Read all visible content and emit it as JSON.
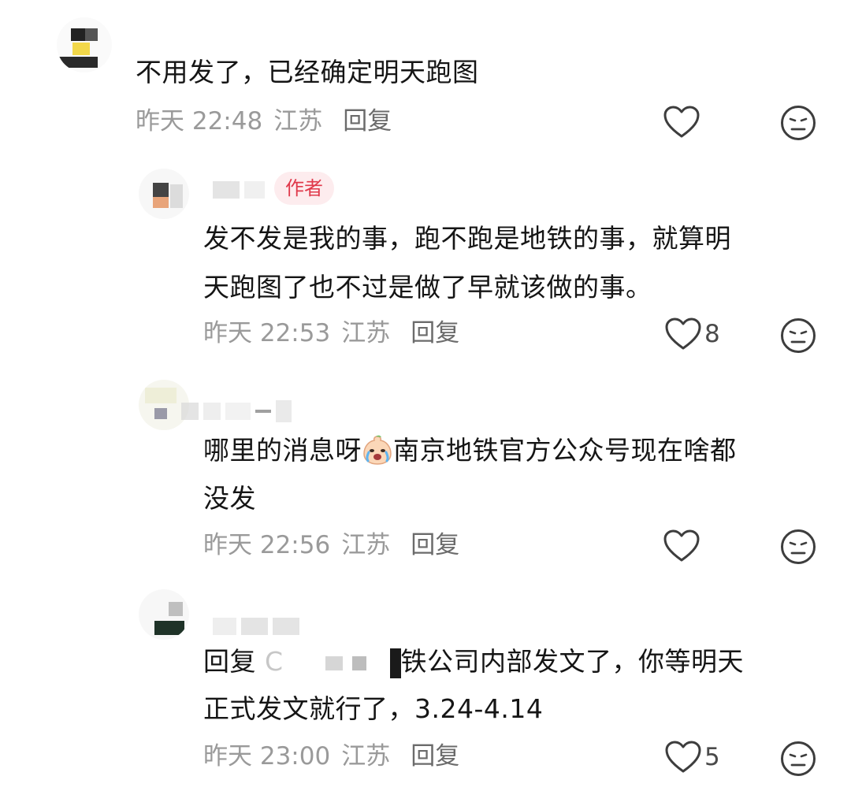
{
  "comments": [
    {
      "text": "不用发了，已经确定明天跑图",
      "time": "昨天 22:48",
      "location": "江苏",
      "reply_label": "回复",
      "likes": "",
      "like_icon": "heart-outline",
      "dislike_icon": "neutral-face"
    },
    {
      "badge": "作者",
      "text_line1": "发不发是我的事，跑不跑是地铁的事，就算明",
      "text_line2": "天跑图了也不过是做了早就该做的事。",
      "time": "昨天 22:53",
      "location": "江苏",
      "reply_label": "回复",
      "likes": "8",
      "like_icon": "heart-outline",
      "dislike_icon": "neutral-face"
    },
    {
      "text_line1_a": "哪里的消息呀",
      "text_line1_b": "南京地铁官方公众号现在啥都",
      "text_line2": "没发",
      "emoji": "crying-face",
      "time": "昨天 22:56",
      "location": "江苏",
      "reply_label": "回复",
      "likes": "",
      "like_icon": "heart-outline",
      "dislike_icon": "neutral-face"
    },
    {
      "text_line1_prefix": "回复",
      "text_line1_partial": "C",
      "text_line1_rest": "铁公司内部发文了，你等明天",
      "text_line2": "正式发文就行了，3.24-4.14",
      "time": "昨天 23:00",
      "location": "江苏",
      "reply_label": "回复",
      "likes": "5",
      "like_icon": "heart-outline",
      "dislike_icon": "neutral-face"
    }
  ],
  "colors": {
    "text": "#151515",
    "meta": "#9a9a9a",
    "reply": "#6b6b6b",
    "badge_bg": "#fdecee",
    "badge_text": "#e0394b",
    "icon": "#3d3d3d"
  }
}
